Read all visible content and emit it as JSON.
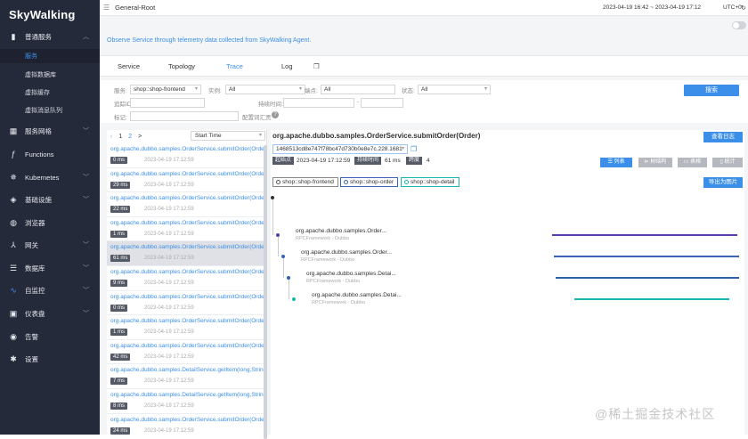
{
  "app": {
    "name": "SkyWalking"
  },
  "sidebar": {
    "items": [
      {
        "label": "普通服务",
        "icon": "chart-bar-icon",
        "expanded": true
      },
      {
        "label": "服务网格",
        "icon": "grid-icon"
      },
      {
        "label": "Functions",
        "icon": "function-icon"
      },
      {
        "label": "Kubernetes",
        "icon": "kubernetes-icon"
      },
      {
        "label": "基础设施",
        "icon": "infrastructure-icon"
      },
      {
        "label": "浏览器",
        "icon": "globe-icon"
      },
      {
        "label": "网关",
        "icon": "gateway-icon"
      },
      {
        "label": "数据库",
        "icon": "database-icon"
      },
      {
        "label": "自监控",
        "icon": "self-monitor-icon"
      },
      {
        "label": "仪表盘",
        "icon": "dashboard-icon"
      },
      {
        "label": "告警",
        "icon": "alarm-icon"
      },
      {
        "label": "设置",
        "icon": "gear-icon"
      }
    ],
    "sub_items": [
      "服务",
      "虚拟数据库",
      "虚拟缓存",
      "虚拟消息队列"
    ]
  },
  "topbar": {
    "breadcrumb": "General-Root",
    "time_range": "2023-04-19 16:42 ~ 2023-04-19 17:12",
    "timezone": "UTC+0"
  },
  "tip": "Observe Service through telemetry data collected from SkyWalking Agent.",
  "tabs": [
    "Service",
    "Topology",
    "Trace",
    "Log"
  ],
  "active_tab": "Trace",
  "filters": {
    "service_label": "服务:",
    "service_value": "shop::shop-frontend",
    "instance_label": "实例:",
    "instance_value": "All",
    "endpoint_label": "端点:",
    "endpoint_value": "All",
    "status_label": "状态:",
    "status_value": "All",
    "trace_id_label": "追踪ID:",
    "duration_label": "持续时间:",
    "duration_sep": "-",
    "tags_label": "标记:",
    "tags_hint": "配置词汇贡",
    "search_button": "搜索"
  },
  "trace_list": {
    "pager": [
      "1",
      "2",
      ">"
    ],
    "sort": "Start Time",
    "rows": [
      {
        "name": "org.apache.dubbo.samples.OrderService.submitOrder(Order)",
        "duration": "0 ms",
        "time": "2023-04-19 17:12:59"
      },
      {
        "name": "org.apache.dubbo.samples.OrderService.submitOrder(Order)",
        "duration": "29 ms",
        "time": "2023-04-19 17:12:59"
      },
      {
        "name": "org.apache.dubbo.samples.OrderService.submitOrder(Order)",
        "duration": "22 ms",
        "time": "2023-04-19 17:12:59"
      },
      {
        "name": "org.apache.dubbo.samples.OrderService.submitOrder(Order)",
        "duration": "1 ms",
        "time": "2023-04-19 17:12:59"
      },
      {
        "name": "org.apache.dubbo.samples.OrderService.submitOrder(Order)",
        "duration": "61 ms",
        "time": "2023-04-19 17:12:59",
        "selected": true
      },
      {
        "name": "org.apache.dubbo.samples.OrderService.submitOrder(Order)",
        "duration": "9 ms",
        "time": "2023-04-19 17:12:59"
      },
      {
        "name": "org.apache.dubbo.samples.OrderService.submitOrder(Order)",
        "duration": "0 ms",
        "time": "2023-04-19 17:12:59"
      },
      {
        "name": "org.apache.dubbo.samples.OrderService.submitOrder(Order)",
        "duration": "1 ms",
        "time": "2023-04-19 17:12:59"
      },
      {
        "name": "org.apache.dubbo.samples.OrderService.submitOrder(Order)",
        "duration": "42 ms",
        "time": "2023-04-19 17:12:59"
      },
      {
        "name": "org.apache.dubbo.samples.DetailService.getItem(long,String)",
        "duration": "7 ms",
        "time": "2023-04-19 17:12:59"
      },
      {
        "name": "org.apache.dubbo.samples.DetailService.getItem(long,String)",
        "duration": "8 ms",
        "time": "2023-04-19 17:12:59"
      },
      {
        "name": "org.apache.dubbo.samples.OrderService.submitOrder(Order)",
        "duration": "24 ms",
        "time": "2023-04-19 17:12:59"
      }
    ]
  },
  "detail": {
    "title": "org.apache.dubbo.samples.OrderService.submitOrder(Order)",
    "view_logs": "查看日志",
    "trace_id": "1468513cd8e747f78bc47d730b0e8e7c.228.1681",
    "start_label": "起始点",
    "start_value": "2023-04-19 17:12:59",
    "duration_label": "持续时间",
    "duration_value": "61 ms",
    "span_label": "跨度",
    "span_value": "4",
    "view_buttons": [
      "☰ 列表",
      "⊳ 树结构",
      "▭ 表格",
      "▯ 统计"
    ],
    "services": [
      {
        "name": "shop::shop-frontend",
        "color": "#555555"
      },
      {
        "name": "shop::shop-order",
        "color": "#3b63b8"
      },
      {
        "name": "shop::shop-detail",
        "color": "#19b6b0"
      }
    ],
    "export_button": "导出为图片",
    "spans": [
      {
        "name": "org.apache.dubbo.samples.Order...",
        "component": "RPCFramework - Dubbo",
        "color": "#5b3ea8",
        "start": 0.0,
        "end": 0.98
      },
      {
        "name": "org.apache.dubbo.samples.Order...",
        "component": "RPCFramework - Dubbo",
        "color": "#3b63b8",
        "start": 0.01,
        "end": 0.99
      },
      {
        "name": "org.apache.dubbo.samples.Detai...",
        "component": "RPCFramework - Dubbo",
        "color": "#2f5fa8",
        "start": 0.02,
        "end": 0.99
      },
      {
        "name": "org.apache.dubbo.samples.Detai...",
        "component": "RPCFramework - Dubbo",
        "color": "#19b6b0",
        "start": 0.12,
        "end": 0.94
      }
    ]
  },
  "watermark": "@稀土掘金技术社区"
}
